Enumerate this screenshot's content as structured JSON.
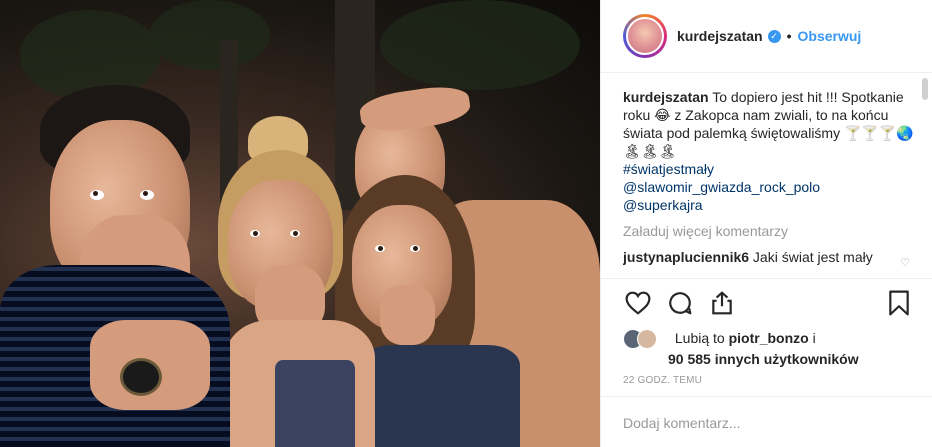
{
  "post": {
    "username": "kurdejszatan",
    "follow_label": "Obserwuj",
    "caption_user": "kurdejszatan",
    "caption_text": " To dopiero jest hit !!! Spotkanie roku 😂 z Zakopca nam zwiali, to na końcu świata pod palemką świętowaliśmy 🍸🍸🍸🌏🏝🏝🏝",
    "hashtag": "#światjestmały",
    "mention1": "@slawomir_gwiazda_rock_polo",
    "mention2": "@superkajra",
    "load_more": "Załaduj więcej komentarzy",
    "comment_user": "justynaplucienni k6",
    "comment_user_clean": "justynaplucienni k6",
    "comment_username": "justynapluciennik6",
    "comment_text": " Jaki świat jest mały",
    "likes_prefix": "Lubią to ",
    "likes_user": "piotr_bonzo",
    "likes_mid": " i",
    "likes_count": "90 585 innych użytkowników",
    "timestamp": "22 GODZ. TEMU",
    "add_comment_placeholder": "Dodaj komentarz..."
  },
  "icons": {
    "like": "heart-icon",
    "comment": "comment-icon",
    "share": "share-icon",
    "save": "bookmark-icon",
    "verified": "verified-badge-icon"
  },
  "colors": {
    "link": "#003569",
    "follow": "#3897f0",
    "muted": "#999999"
  }
}
